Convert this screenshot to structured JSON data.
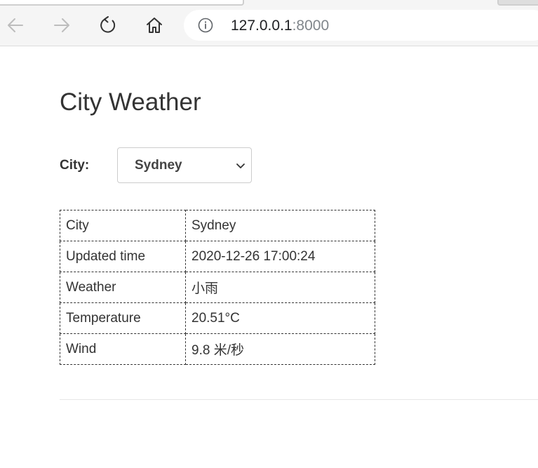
{
  "browser": {
    "url_host": "127.0.0.1",
    "url_port": ":8000",
    "icons": {
      "back": "arrow-left-icon",
      "forward": "arrow-right-icon",
      "reload": "reload-icon",
      "home": "home-icon",
      "info": "info-icon"
    }
  },
  "page": {
    "title": "City Weather",
    "city_label": "City:",
    "city_select": {
      "selected": "Sydney"
    },
    "weather_table": {
      "rows": [
        {
          "label": "City",
          "value": "Sydney"
        },
        {
          "label": "Updated time",
          "value": "2020-12-26 17:00:24"
        },
        {
          "label": "Weather",
          "value": "小雨"
        },
        {
          "label": "Temperature",
          "value": "20.51°C"
        },
        {
          "label": "Wind",
          "value": "9.8 米/秒"
        }
      ]
    }
  },
  "colors": {
    "text": "#333333",
    "chrome_bg": "#f5f5f5",
    "disabled_icon": "#bdbdbd",
    "active_icon": "#333333",
    "url_port": "#80868b"
  }
}
